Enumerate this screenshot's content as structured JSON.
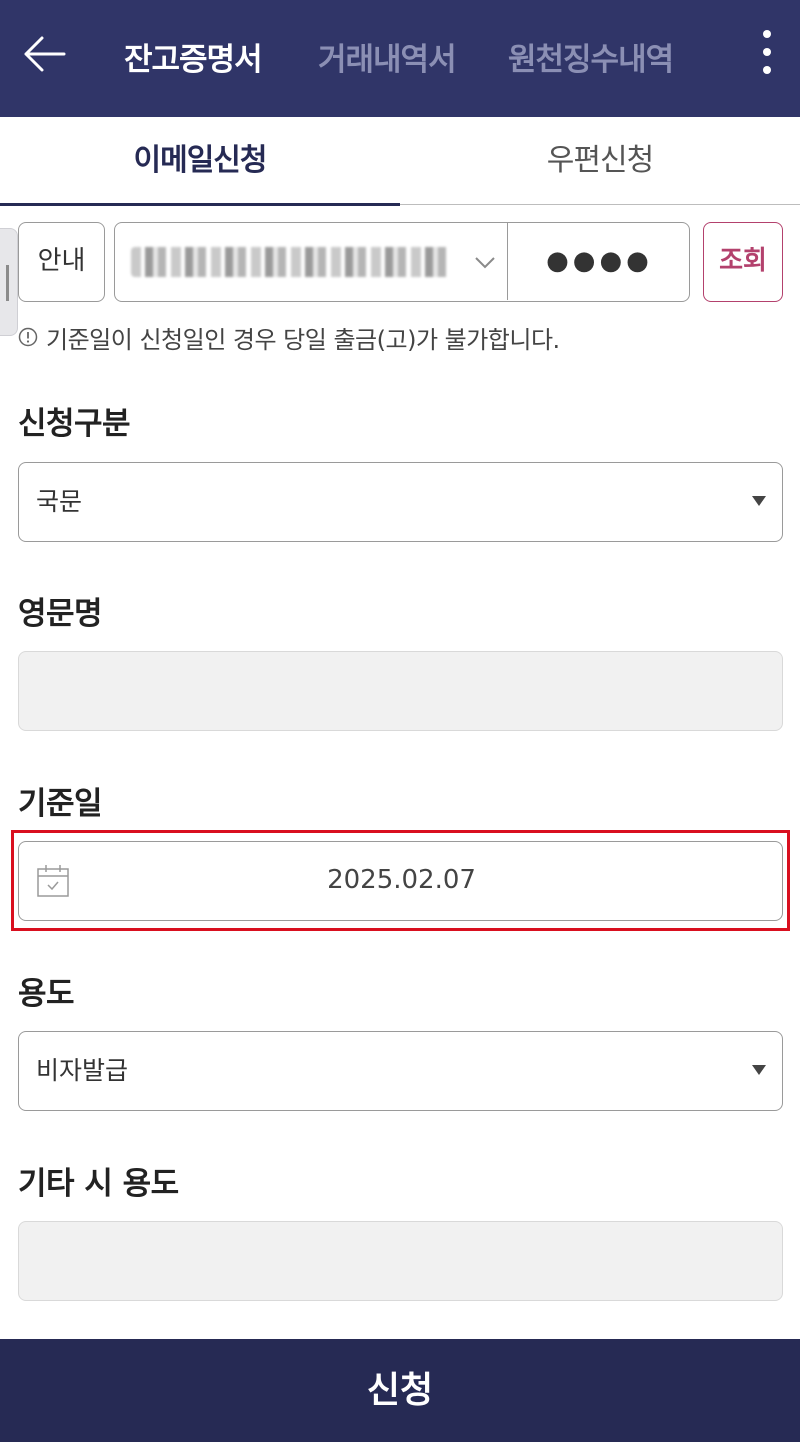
{
  "header": {
    "tabs": [
      {
        "label": "잔고증명서",
        "active": true
      },
      {
        "label": "거래내역서",
        "active": false
      },
      {
        "label": "원천징수내역",
        "active": false
      }
    ],
    "back_icon": "arrow-left-icon",
    "menu_icon": "more-vertical-icon"
  },
  "subtabs": [
    {
      "label": "이메일신청",
      "active": true
    },
    {
      "label": "우편신청",
      "active": false
    }
  ],
  "account_row": {
    "info_button": "안내",
    "password_dots": "●●●●",
    "inquiry_button": "조회"
  },
  "notice": {
    "icon": "info-circle-icon",
    "text": "기준일이 신청일인 경우 당일 출금(고)가 불가합니다."
  },
  "form": {
    "request_type": {
      "label": "신청구분",
      "value": "국문"
    },
    "english_name": {
      "label": "영문명",
      "value": ""
    },
    "base_date": {
      "label": "기준일",
      "value": "2025.02.07",
      "icon": "calendar-icon"
    },
    "purpose": {
      "label": "용도",
      "value": "비자발급"
    },
    "other_purpose": {
      "label": "기타 시 용도",
      "value": ""
    }
  },
  "submit": {
    "label": "신청"
  },
  "colors": {
    "header_bg": "#303568",
    "accent": "#262a54",
    "inquiry": "#b3416d",
    "highlight": "#d90f1f"
  }
}
